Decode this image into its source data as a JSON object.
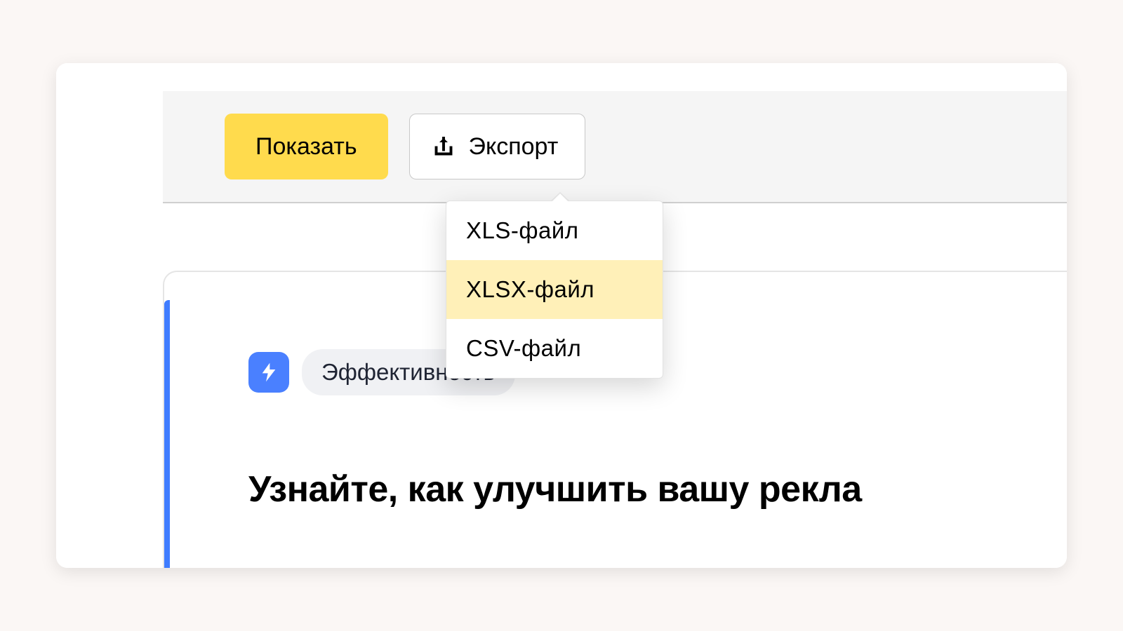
{
  "toolbar": {
    "show_label": "Показать",
    "export_label": "Экспорт"
  },
  "export_menu": {
    "items": [
      {
        "label": "XLS-файл",
        "highlighted": false
      },
      {
        "label": "XLSX-файл",
        "highlighted": true
      },
      {
        "label": "CSV-файл",
        "highlighted": false
      }
    ]
  },
  "panel": {
    "tag_label": "Эффективность",
    "headline": "Узнайте, как улучшить вашу рекла"
  },
  "icons": {
    "export": "export-icon",
    "lightning": "lightning-icon"
  },
  "colors": {
    "primary_button": "#FFDB4D",
    "highlight": "#FFF0B8",
    "accent_blue": "#4A80FF",
    "left_border": "#3f7cff"
  }
}
